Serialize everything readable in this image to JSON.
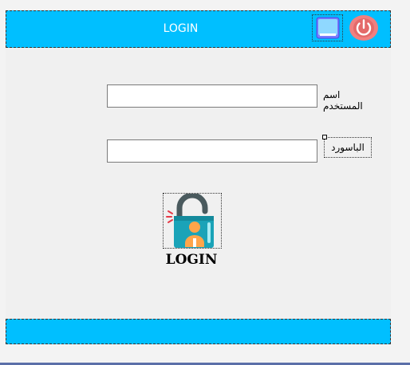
{
  "header": {
    "title": "LOGIN",
    "minimize_icon": "minimize-window-icon",
    "power_icon": "power-icon"
  },
  "form": {
    "username_label": "اسم المستخدم",
    "username_value": "",
    "password_label": "الباسورد",
    "password_value": "",
    "login_icon": "padlock-user-icon",
    "login_label": "LOGIN"
  },
  "colors": {
    "header_bg": "#00bfff",
    "footer_bg": "#00bfff",
    "form_bg": "#f0f0f0",
    "power_button": "#f08080"
  }
}
